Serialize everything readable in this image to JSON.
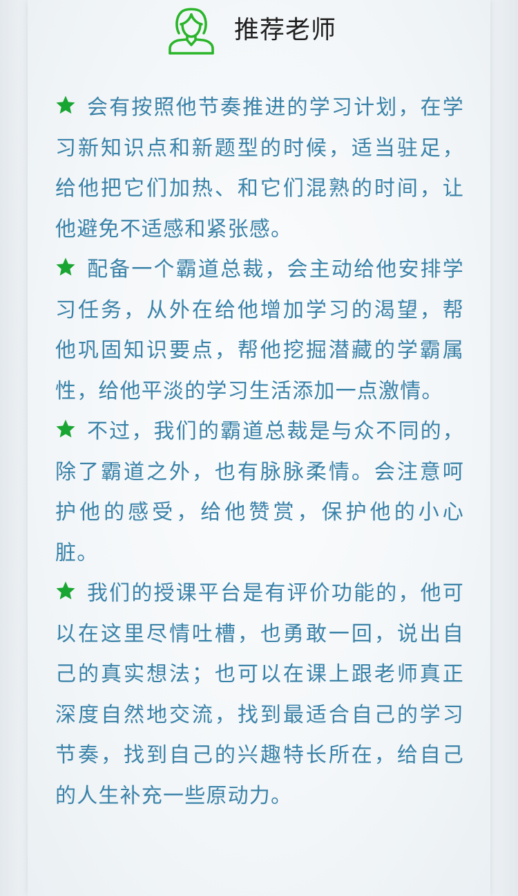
{
  "header": {
    "title": "推荐老师",
    "icon": "teacher-female-icon",
    "accent_color": "#2ab52a"
  },
  "paragraphs": [
    "会有按照他节奏推进的学习计划，在学习新知识点和新题型的时候，适当驻足，给他把它们加热、和它们混熟的时间，让他避免不适感和紧张感。",
    "配备一个霸道总裁，会主动给他安排学习任务，从外在给他增加学习的渴望，帮他巩固知识要点，帮他挖掘潜藏的学霸属性，给他平淡的学习生活添加一点激情。",
    "不过，我们的霸道总裁是与众不同的，除了霸道之外，也有脉脉柔情。会注意呵护他的感受，给他赞赏，保护他的小心脏。",
    "我们的授课平台是有评价功能的，他可以在这里尽情吐槽，也勇敢一回，说出自己的真实想法；也可以在课上跟老师真正深度自然地交流，找到最适合自己的学习节奏，找到自己的兴趣特长所在，给自己的人生补充一些原动力。"
  ],
  "bullet_icon": "star-icon",
  "text_color": "#3a82a8"
}
